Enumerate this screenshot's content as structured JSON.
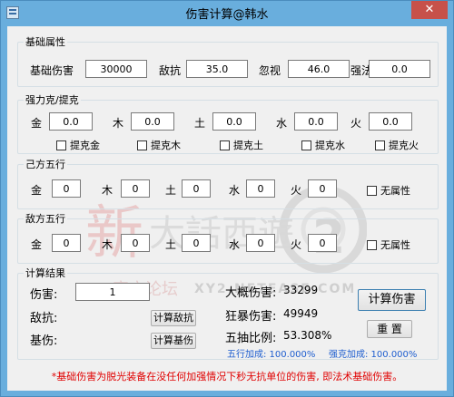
{
  "window": {
    "title": "伤害计算@韩水",
    "close": "✕"
  },
  "base": {
    "group_title": "基础属性",
    "damage_label": "基础伤害",
    "damage_value": "30000",
    "resist_label": "敌抗",
    "resist_value": "35.0",
    "ignore_label": "忽视",
    "ignore_value": "46.0",
    "spell_label": "强法",
    "spell_value": "0.0"
  },
  "strong": {
    "group_title": "强力克/提克",
    "elements": [
      {
        "label": "金",
        "value": "0.0",
        "check": "提克金"
      },
      {
        "label": "木",
        "value": "0.0",
        "check": "提克木"
      },
      {
        "label": "土",
        "value": "0.0",
        "check": "提克土"
      },
      {
        "label": "水",
        "value": "0.0",
        "check": "提克水"
      },
      {
        "label": "火",
        "value": "0.0",
        "check": "提克火"
      }
    ]
  },
  "self_five": {
    "group_title": "己方五行",
    "elements": [
      {
        "label": "金",
        "value": "0"
      },
      {
        "label": "木",
        "value": "0"
      },
      {
        "label": "土",
        "value": "0"
      },
      {
        "label": "水",
        "value": "0"
      },
      {
        "label": "火",
        "value": "0"
      }
    ],
    "check": "无属性"
  },
  "enemy_five": {
    "group_title": "敌方五行",
    "elements": [
      {
        "label": "金",
        "value": "0"
      },
      {
        "label": "木",
        "value": "0"
      },
      {
        "label": "土",
        "value": "0"
      },
      {
        "label": "水",
        "value": "0"
      },
      {
        "label": "火",
        "value": "0"
      }
    ],
    "check": "无属性"
  },
  "result": {
    "group_title": "计算结果",
    "damage_label": "伤害:",
    "damage_value": "1",
    "resist_label": "敌抗:",
    "calc_resist_button": "计算敌抗",
    "base_label": "基伤:",
    "calc_base_button": "计算基伤",
    "approx_label": "大概伤害:",
    "approx_value": "33299",
    "crit_label": "狂暴伤害:",
    "crit_value": "49949",
    "ratio_label": "五抽比例:",
    "ratio_value": "53.308%",
    "calc_damage_button": "计算伤害",
    "reset_button": "重 置",
    "five_bonus": "五行加成: 100.000%",
    "strong_bonus": "强克加成: 100.000%"
  },
  "footnote": "*基础伤害为脱光装备在没任何加强情况下秒无抗单位的伤害, 即法术基础伤害。",
  "watermark": {
    "title": "新大话西游2",
    "subtitle": "官方论坛",
    "url": "XY2.NETEASE.COM"
  }
}
